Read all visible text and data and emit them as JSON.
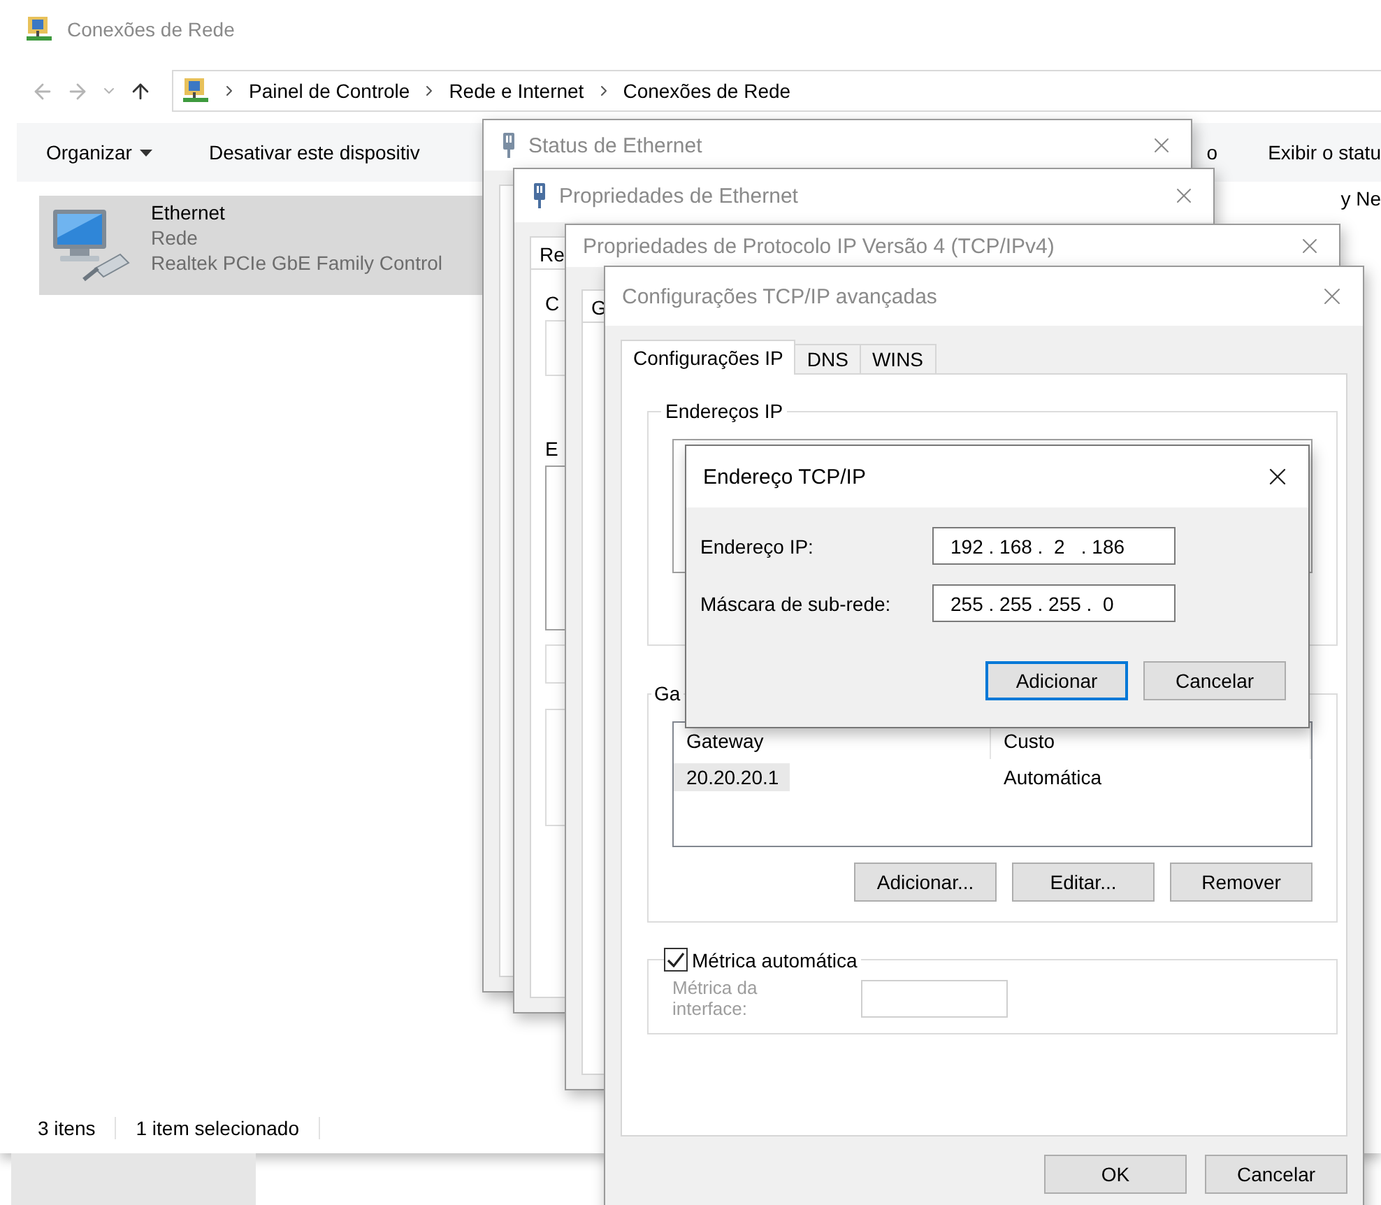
{
  "explorer": {
    "title": "Conexões de Rede",
    "breadcrumb": [
      "Painel de Controle",
      "Rede e Internet",
      "Conexões de Rede"
    ],
    "toolbar_left": [
      {
        "label": "Organizar",
        "kind": "menu"
      },
      {
        "label": "Desativar este dispositiv",
        "kind": "button"
      }
    ],
    "toolbar_right": [
      "o",
      "Exibir o statu"
    ],
    "items": [
      {
        "kind": "adapter",
        "name": "Ethernet",
        "network": "Rede",
        "device": "Realtek PCIe GbE Family Control",
        "selected": true
      },
      {
        "kind": "fragment",
        "name": "y Ne",
        "selected": false
      }
    ],
    "status_bar": [
      "3 itens",
      "1 item selecionado"
    ]
  },
  "status_window": {
    "title": "Status de Ethernet"
  },
  "ethernet_properties": {
    "title": "Propriedades de Ethernet",
    "tab_fragment": "Re",
    "label_fragments": [
      "C",
      "E"
    ]
  },
  "ipv4_properties": {
    "title": "Propriedades de Protocolo IP Versão 4 (TCP/IPv4)",
    "tab_fragment": "G"
  },
  "advanced": {
    "title": "Configurações TCP/IP avançadas",
    "tabs": [
      {
        "label": "Configurações IP",
        "selected": true
      },
      {
        "label": "DNS",
        "selected": false
      },
      {
        "label": "WINS",
        "selected": false
      }
    ],
    "ip_group": {
      "legend": "Endereços IP"
    },
    "gateway_group": {
      "legend": "Ga",
      "columns": [
        "Gateway",
        "Custo"
      ],
      "rows": [
        {
          "cells": [
            "20.20.20.1",
            "Automática"
          ],
          "selected": true
        }
      ],
      "buttons": [
        "Adicionar...",
        "Editar...",
        "Remover"
      ]
    },
    "metric": {
      "label": "Métrica automática",
      "checked": true,
      "field_label": "Métrica da interface:",
      "disabled": true
    },
    "buttons": [
      "OK",
      "Cancelar"
    ]
  },
  "address_popup": {
    "title": "Endereço TCP/IP",
    "fields": [
      {
        "label": "Endereço IP:",
        "value": "192 . 168 .  2   . 186"
      },
      {
        "label": "Máscara de sub-rede:",
        "value": "255 . 255 . 255 .  0"
      }
    ],
    "buttons": [
      {
        "label": "Adicionar",
        "default": true
      },
      {
        "label": "Cancelar",
        "default": false
      }
    ]
  }
}
